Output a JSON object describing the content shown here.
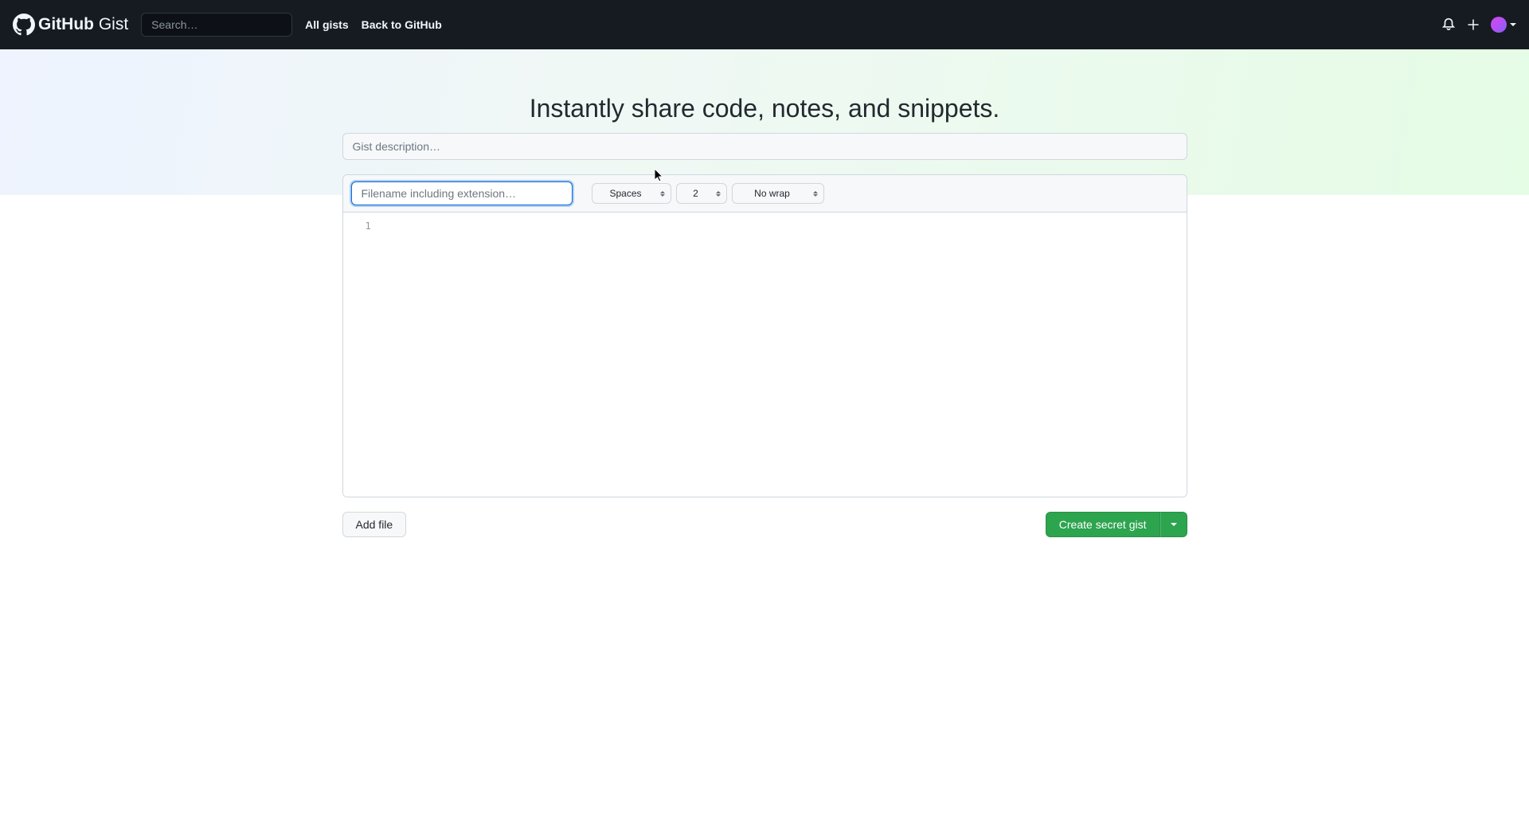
{
  "header": {
    "logo_primary": "GitHub",
    "logo_secondary": "Gist",
    "search_placeholder": "Search…",
    "nav": {
      "all_gists": "All gists",
      "back_to_github": "Back to GitHub"
    }
  },
  "hero": {
    "title": "Instantly share code, notes, and snippets."
  },
  "form": {
    "description_placeholder": "Gist description…",
    "filename_placeholder": "Filename including extension…",
    "indent_mode": "Spaces",
    "indent_size": "2",
    "wrap_mode": "No wrap"
  },
  "editor": {
    "line_numbers": [
      "1"
    ]
  },
  "actions": {
    "add_file": "Add file",
    "create_gist": "Create secret gist"
  }
}
